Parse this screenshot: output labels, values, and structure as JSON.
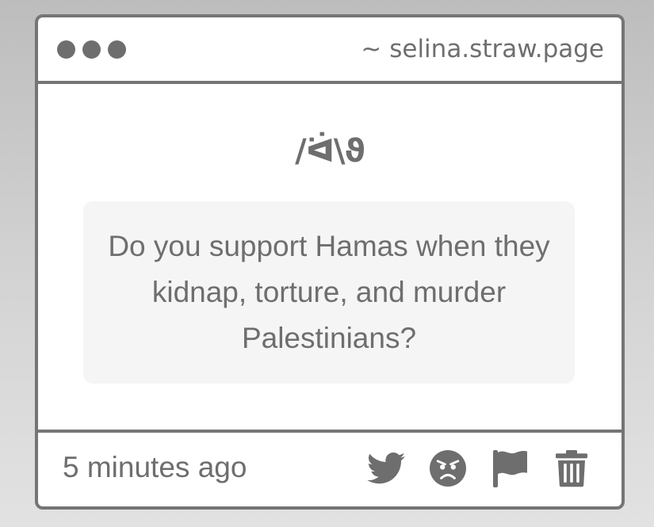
{
  "window": {
    "url": "~ selina.straw.page"
  },
  "question": {
    "kaomoji": "/ᐛ\\ϑ",
    "text": "Do you support Hamas when they kidnap, torture, and murder Palestinians?"
  },
  "footer": {
    "timestamp": "5 minutes ago",
    "actions": [
      {
        "name": "share-on-twitter",
        "icon": "twitter-icon"
      },
      {
        "name": "angry-reaction",
        "icon": "angry-face-icon"
      },
      {
        "name": "report",
        "icon": "flag-icon"
      },
      {
        "name": "delete",
        "icon": "trash-icon"
      }
    ]
  },
  "colors": {
    "frame": "#757575",
    "text": "#6e6e6e",
    "question_background": "#f5f5f5",
    "page_background": "#cccccc"
  }
}
